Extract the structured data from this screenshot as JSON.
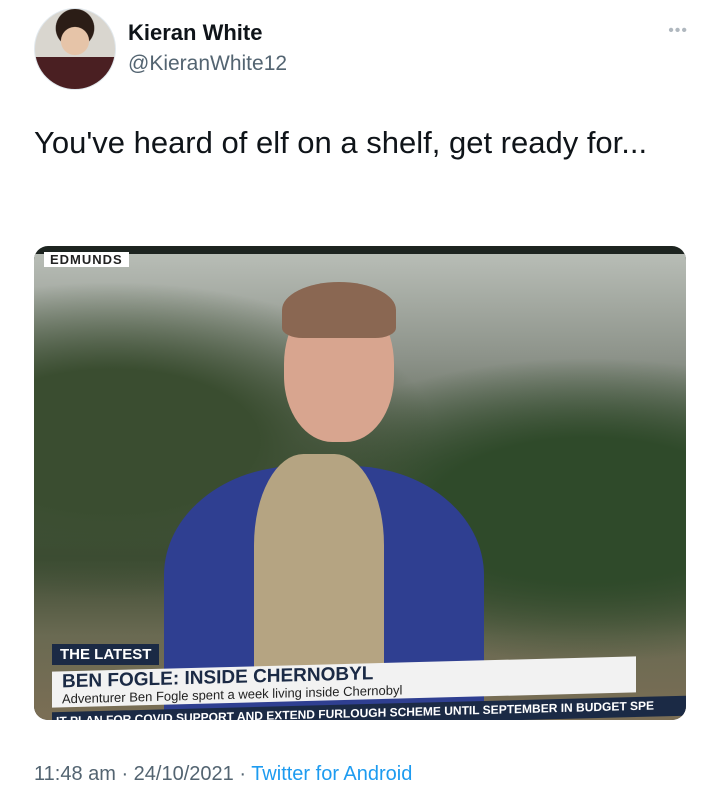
{
  "tweet": {
    "author_name": "Kieran White",
    "author_handle": "@KieranWhite12",
    "more_icon": "•••",
    "text": "You've heard of elf on a shelf, get ready for...",
    "timestamp": "11:48 am · 24/10/2021 · ",
    "source": "Twitter for Android"
  },
  "media": {
    "station_label": "EDMUNDS",
    "tag": "THE LATEST",
    "headline": "BEN FOGLE: INSIDE CHERNOBYL",
    "subheadline": "Adventurer Ben Fogle spent a week living inside Chernobyl",
    "ticker": "IT PLAN FOR COVID SUPPORT AND EXTEND FURLOUGH SCHEME UNTIL SEPTEMBER IN BUDGET SPE"
  },
  "colors": {
    "link": "#1d9bf0",
    "secondary_text": "#536471",
    "banner_navy": "#1b2a45"
  }
}
